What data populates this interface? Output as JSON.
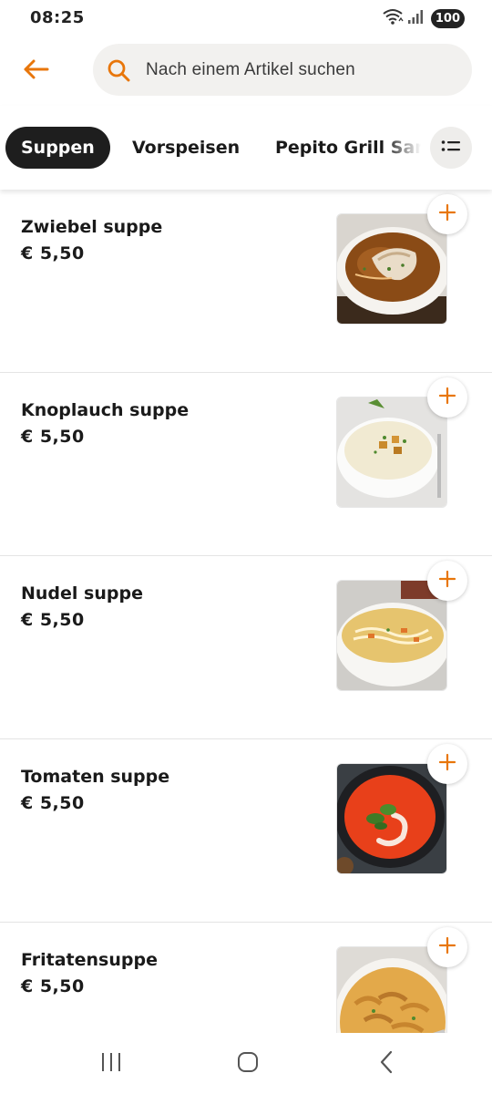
{
  "status_bar": {
    "time": "08:25",
    "battery": "100",
    "icons": [
      "wifi-icon",
      "signal-icon",
      "battery-icon"
    ]
  },
  "header": {
    "back_icon": "arrow-left-icon",
    "search": {
      "placeholder": "Nach einem Artikel suchen",
      "icon": "search-icon"
    }
  },
  "categories": {
    "tabs": [
      {
        "label": "Suppen",
        "active": true
      },
      {
        "label": "Vorspeisen",
        "active": false
      },
      {
        "label": "Pepito Grill Sandwiches",
        "active": false
      }
    ],
    "filter_icon": "list-icon"
  },
  "items": [
    {
      "name": "Zwiebel suppe",
      "price": "€ 5,50"
    },
    {
      "name": "Knoplauch suppe",
      "price": "€ 5,50"
    },
    {
      "name": "Nudel suppe",
      "price": "€ 5,50"
    },
    {
      "name": "Tomaten suppe",
      "price": "€ 5,50"
    },
    {
      "name": "Fritatensuppe",
      "price": "€ 5,50"
    }
  ],
  "nav_bar": {
    "icons": [
      "recent-apps-icon",
      "home-icon",
      "back-icon"
    ]
  },
  "colors": {
    "accent": "#e8760a",
    "tab_active_bg": "#1e1e1e",
    "search_bg": "#f2f1ef"
  }
}
